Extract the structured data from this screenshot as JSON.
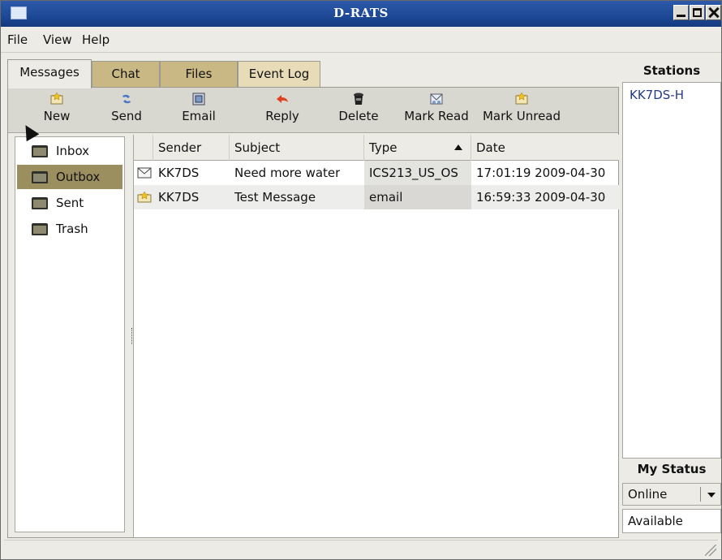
{
  "window": {
    "title": "D-RATS"
  },
  "menu": {
    "file": "File",
    "view": "View",
    "help": "Help"
  },
  "tabs": [
    {
      "label": "Messages",
      "active": true
    },
    {
      "label": "Chat",
      "active": false
    },
    {
      "label": "Files",
      "active": false
    },
    {
      "label": "Event Log",
      "active": false
    }
  ],
  "toolbar": {
    "new": "New",
    "send": "Send",
    "email": "Email",
    "reply": "Reply",
    "delete": "Delete",
    "mark_read": "Mark Read",
    "mark_unread": "Mark Unread"
  },
  "folders": [
    {
      "label": "Inbox",
      "selected": false
    },
    {
      "label": "Outbox",
      "selected": true
    },
    {
      "label": "Sent",
      "selected": false
    },
    {
      "label": "Trash",
      "selected": false
    }
  ],
  "table": {
    "headers": {
      "sender": "Sender",
      "subject": "Subject",
      "type": "Type",
      "date": "Date"
    },
    "sort_column": "Type",
    "sort_direction": "ascending",
    "rows": [
      {
        "icon": "envelope-icon",
        "sender": "KK7DS",
        "subject": "Need more water",
        "type": "ICS213_US_OS",
        "date": "17:01:19 2009-04-30"
      },
      {
        "icon": "unread-star-envelope-icon",
        "sender": "KK7DS",
        "subject": "Test Message",
        "type": "email",
        "date": "16:59:33 2009-04-30"
      }
    ]
  },
  "sidebar": {
    "stations_title": "Stations",
    "stations": [
      "KK7DS-H"
    ],
    "my_status_title": "My Status",
    "status_value": "Online",
    "status_message": "Available"
  },
  "colors": {
    "titlebar": "#1e4a97",
    "selected_folder": "#9b8f5f",
    "inactive_tab": "#c9b884",
    "station_text": "#233a8a"
  }
}
